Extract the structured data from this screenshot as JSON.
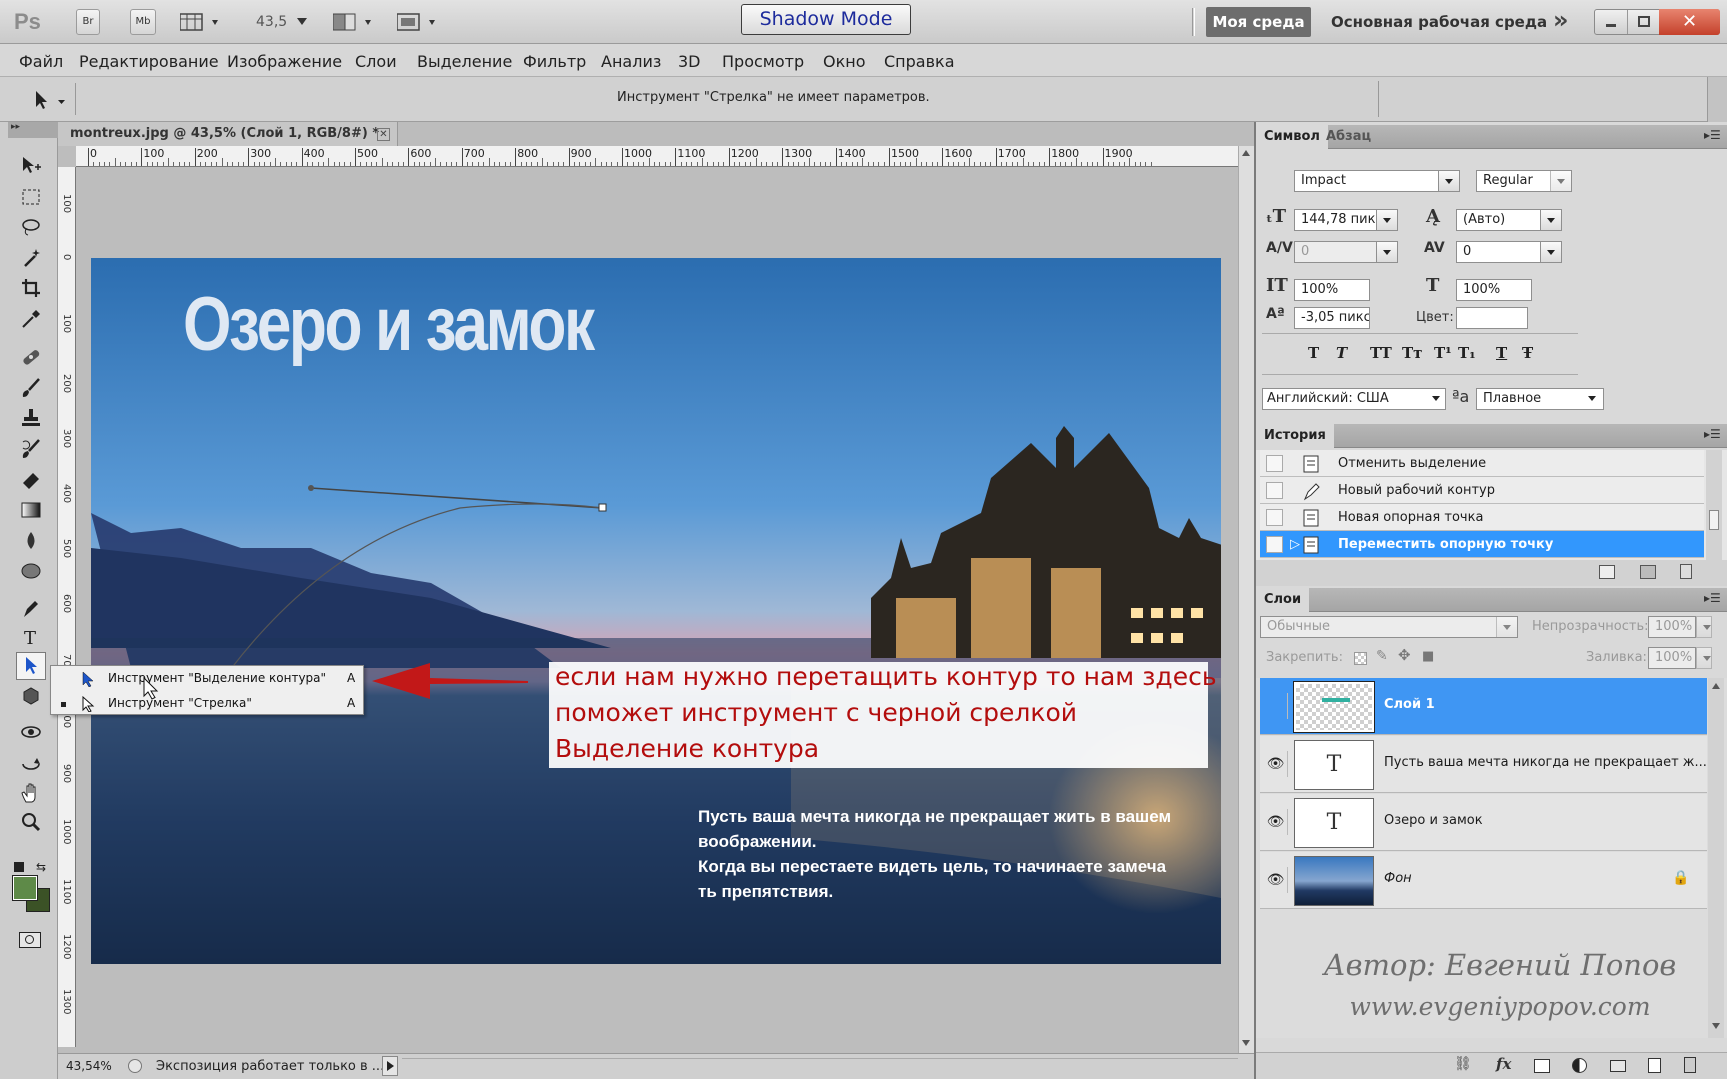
{
  "titlebar": {
    "app_icon": "Ps",
    "bridge": "Br",
    "minibridge": "Mb",
    "zoom": "43,5",
    "center_badge": "Shadow Mode",
    "workspace_mine": "Моя среда",
    "workspace_main": "Основная рабочая среда",
    "more": "»"
  },
  "menu": [
    "Файл",
    "Редактирование",
    "Изображение",
    "Слои",
    "Выделение",
    "Фильтр",
    "Анализ",
    "3D",
    "Просмотр",
    "Окно",
    "Справка"
  ],
  "options_bar": {
    "message": "Инструмент \"Стрелка\" не имеет параметров."
  },
  "document": {
    "tab_title": "montreux.jpg @ 43,5% (Слой 1, RGB/8#) *",
    "ruler_ticks": [
      "0",
      "100",
      "200",
      "300",
      "400",
      "500",
      "600",
      "700",
      "800",
      "900",
      "1000",
      "1100",
      "1200",
      "1300",
      "1400",
      "1500",
      "1600",
      "1700",
      "1800",
      "1900"
    ],
    "headline": "Озеро и замок",
    "quote_lines": [
      "Пусть ваша мечта никогда не прекращает жить в вашем",
      "воображении.",
      "Когда вы перестаете видеть цель, то начинаете замеча",
      "ть препятствия."
    ]
  },
  "flyout": [
    {
      "label": "Инструмент \"Выделение контура\"",
      "key": "A",
      "current": false
    },
    {
      "label": "Инструмент \"Стрелка\"",
      "key": "A",
      "current": true
    }
  ],
  "annotation": {
    "lines": [
      "если нам нужно перетащить контур то нам здесь",
      "поможет инструмент с черной срелкой",
      "Выделение контура"
    ]
  },
  "statusbar": {
    "zoom": "43,54%",
    "info": "Экспозиция работает только в ..."
  },
  "character_panel": {
    "tabs": [
      "Символ",
      "Абзац"
    ],
    "font_family": "Impact",
    "font_style": "Regular",
    "font_size": "144,78 пик",
    "leading": "(Авто)",
    "kerning": "0",
    "tracking": "0",
    "vscale": "100%",
    "hscale": "100%",
    "baseline": "-3,05 пикс",
    "color_label": "Цвет:",
    "language": "Английский: США",
    "aa_mark": "ªa",
    "antialias": "Плавное",
    "style_buttons": [
      "T",
      "T",
      "TT",
      "Tт",
      "T¹",
      "T₁",
      "T",
      "Ŧ"
    ]
  },
  "history_panel": {
    "title": "История",
    "items": [
      "Отменить выделение",
      "Новый рабочий контур",
      "Новая опорная точка",
      "Переместить опорную точку"
    ],
    "selected_index": 3
  },
  "layers_panel": {
    "title": "Слои",
    "blend_mode": "Обычные",
    "opacity_label": "Непрозрачность:",
    "opacity": "100%",
    "lock_label": "Закрепить:",
    "fill_label": "Заливка:",
    "fill": "100%",
    "layers": [
      {
        "name": "Слой 1",
        "type": "raster",
        "visible": false,
        "selected": true
      },
      {
        "name": "Пусть ваша мечта никогда не прекращает ж...",
        "type": "text",
        "visible": true,
        "selected": false
      },
      {
        "name": "Озеро и замок",
        "type": "text",
        "visible": true,
        "selected": false
      },
      {
        "name": "Фон",
        "type": "background",
        "visible": true,
        "selected": false
      }
    ],
    "watermark": [
      "Автор: Евгений Попов",
      "www.evgeniypopov.com"
    ]
  },
  "colors": {
    "accent": "#3f96f3",
    "note_text": "#b30d0d",
    "foreground": "#5e8a48",
    "background": "#3b5226"
  },
  "icons": [
    "move-icon",
    "marquee-icon",
    "lasso-icon",
    "magic-wand-icon",
    "crop-icon",
    "eyedropper-icon",
    "healing-icon",
    "brush-icon",
    "stamp-icon",
    "history-brush-icon",
    "eraser-icon",
    "gradient-icon",
    "blur-icon",
    "dodge-icon",
    "pen-icon",
    "type-icon",
    "path-select-icon",
    "shape-icon",
    "3d-rotate-icon",
    "3d-orbit-icon",
    "hand-icon",
    "zoom-icon"
  ]
}
